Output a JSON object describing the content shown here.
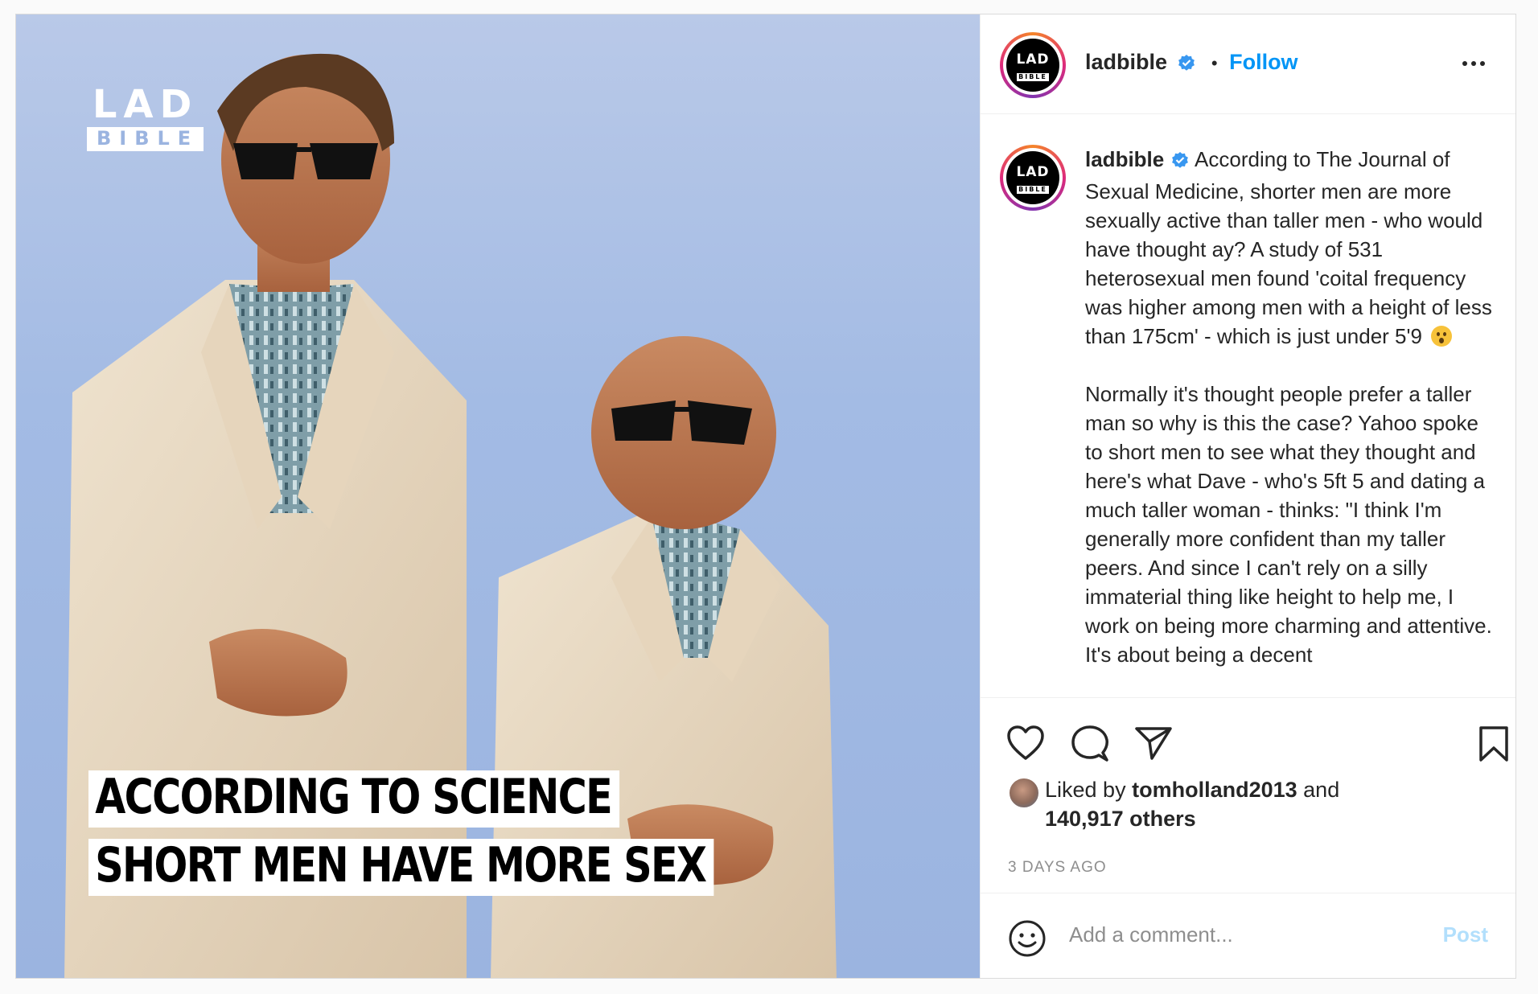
{
  "post": {
    "logo": {
      "line1": "LAD",
      "line2": "BIBLE"
    },
    "image_caption": {
      "line1": "ACCORDING TO SCIENCE",
      "line2": "SHORT MEN HAVE MORE SEX"
    }
  },
  "header": {
    "avatar_text": {
      "line1": "LAD",
      "line2": "BIBLE"
    },
    "username": "ladbible",
    "separator": "•",
    "follow_label": "Follow",
    "more_icon": "more-options-icon"
  },
  "caption": {
    "username": "ladbible",
    "paragraph1": "According to The Journal of Sexual Medicine, shorter men are more sexually active than taller men - who would have thought ay? A study of 531 heterosexual men found 'coital frequency was higher among men with a height of less than 175cm' - which is just under 5'9",
    "paragraph2": "Normally it's thought people prefer a taller man so why is this the case? Yahoo spoke to short men to see what they thought and here's what Dave - who's 5ft 5 and dating a much taller woman - thinks: \"I think I'm generally more confident than my taller peers. And since I can't rely on a silly immaterial thing like height to help me, I work on being more charming and attentive. It's about being a decent"
  },
  "actions": {
    "like_icon": "heart-icon",
    "comment_icon": "comment-icon",
    "share_icon": "paper-plane-icon",
    "save_icon": "bookmark-icon"
  },
  "likes": {
    "prefix": "Liked by",
    "user": "tomholland2013",
    "and": "and",
    "others": "140,917 others"
  },
  "timestamp": "3 DAYS AGO",
  "comment_box": {
    "placeholder": "Add a comment...",
    "post_label": "Post"
  },
  "colors": {
    "accent": "#0095f6",
    "post_disabled": "#b2dffc",
    "verified": "#3897f0",
    "sky": "#9bb4e0"
  }
}
